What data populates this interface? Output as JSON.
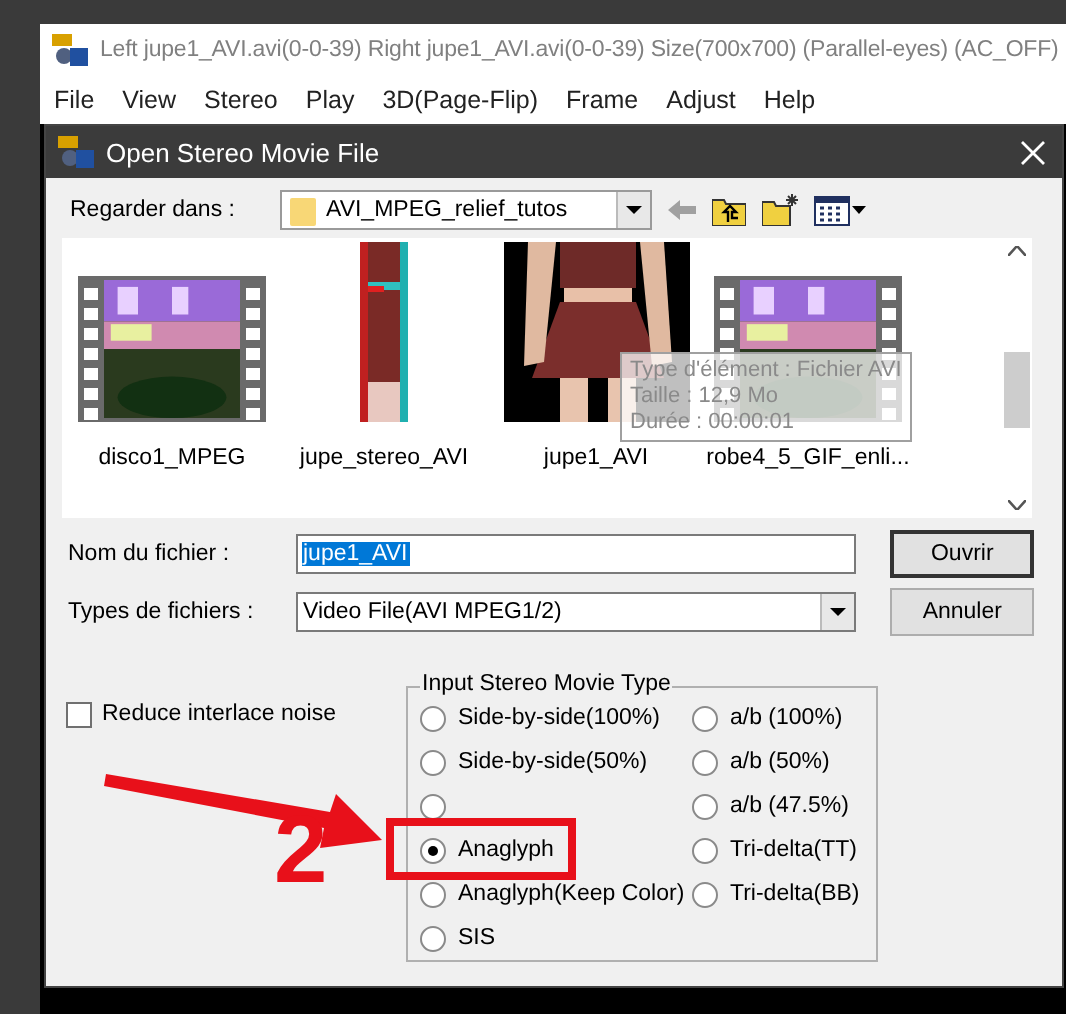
{
  "app_window": {
    "title": "Left jupe1_AVI.avi(0-0-39) Right jupe1_AVI.avi(0-0-39) Size(700x700)  (Parallel-eyes) (AC_OFF)",
    "menu": [
      "File",
      "View",
      "Stereo",
      "Play",
      "3D(Page-Flip)",
      "Frame",
      "Adjust",
      "Help"
    ]
  },
  "dialog": {
    "title": "Open Stereo Movie File",
    "look_in_label": "Regarder dans :",
    "look_in_value": "AVI_MPEG_relief_tutos",
    "files": [
      {
        "name": "disco1_MPEG",
        "kind": "film"
      },
      {
        "name": "jupe_stereo_AVI",
        "kind": "strip"
      },
      {
        "name": "jupe1_AVI"
      },
      {
        "name": "robe4_5_GIF_enli...",
        "kind": "film"
      }
    ],
    "tooltip": [
      "Type d'élément : Fichier AVI",
      "Taille : 12,9 Mo",
      "Durée : 00:00:01"
    ],
    "file_name_label": "Nom du fichier :",
    "file_name_value": "jupe1_AVI",
    "file_type_label": "Types de fichiers :",
    "file_type_value": "Video File(AVI MPEG1/2)",
    "buttons": [
      "Ouvrir",
      "Annuler"
    ],
    "reduce_noise": {
      "label": "Reduce interlace noise",
      "checked": false
    },
    "group": {
      "title": "Input Stereo Movie Type",
      "columns": [
        [
          {
            "label": "Side-by-side(100%)",
            "selected": false
          },
          {
            "label": "Side-by-side(50%)",
            "selected": false
          },
          {
            "selected": false
          },
          {
            "label": "Anaglyph",
            "selected": true
          },
          {
            "label": "Anaglyph(Keep Color)",
            "selected": false
          },
          {
            "label": "SIS",
            "selected": false
          }
        ],
        [
          {
            "label": "a/b (100%)",
            "selected": false
          },
          {
            "label": "a/b (50%)",
            "selected": false
          },
          {
            "label": "a/b (47.5%)",
            "selected": false
          },
          {
            "label": "Tri-delta(TT)",
            "selected": false
          },
          {
            "label": "Tri-delta(BB)",
            "selected": false
          }
        ]
      ]
    }
  },
  "annotation": {
    "label": "2"
  }
}
